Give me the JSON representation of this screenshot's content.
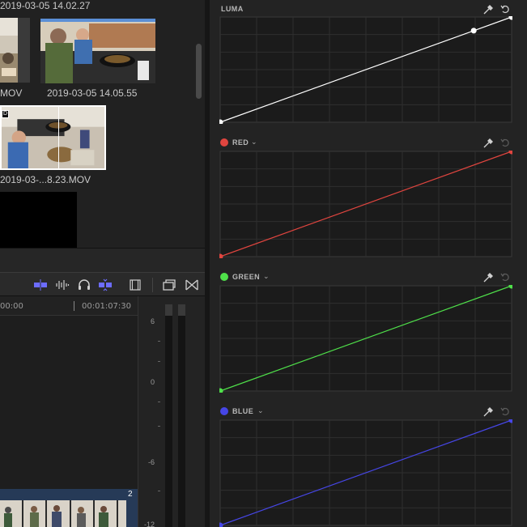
{
  "browser": {
    "clips": [
      {
        "label": "2019-03-05 14.02.27",
        "thumb": "kitchen-clip"
      },
      {
        "label": "MOV",
        "thumb": "kitchen-clip"
      },
      {
        "label": "2019-03-05 14.05.55",
        "thumb": "kitchen-clip-selected"
      },
      {
        "label": "2019-03-...8.23.MOV",
        "thumb": "kitchen-clip-skimmed"
      },
      {
        "label": "",
        "thumb": "black-clip"
      }
    ]
  },
  "timeline": {
    "toolbar_icons": [
      "video-only-icon",
      "waveform-icon",
      "headphones-icon",
      "audio-skimming-icon",
      "filmstrip-icon",
      "clip-appearance-icon",
      "transitions-icon"
    ],
    "timecodes": [
      "00:00",
      "00:01:07:30"
    ],
    "track_number": "2"
  },
  "meters": {
    "labels": [
      "6",
      "0",
      "-6",
      "-12"
    ]
  },
  "colors": {
    "luma": "#ffffff",
    "red": "#e0453f",
    "green": "#4fe04a",
    "blue": "#4646e6",
    "accent": "#5b8fd6"
  },
  "curves": [
    {
      "name": "LUMA",
      "color": "#ffffff",
      "has_dot": false,
      "has_menu": false,
      "points": [
        [
          0,
          0
        ],
        [
          0.87,
          0.87
        ],
        [
          1.0,
          1.0
        ]
      ]
    },
    {
      "name": "RED",
      "color": "#e0453f",
      "has_dot": true,
      "has_menu": true,
      "points": [
        [
          0,
          0
        ],
        [
          1.0,
          1.0
        ]
      ]
    },
    {
      "name": "GREEN",
      "color": "#4fe04a",
      "has_dot": true,
      "has_menu": true,
      "points": [
        [
          0,
          0
        ],
        [
          1.0,
          1.0
        ]
      ]
    },
    {
      "name": "BLUE",
      "color": "#4646e6",
      "has_dot": true,
      "has_menu": true,
      "points": [
        [
          0,
          0
        ],
        [
          1.0,
          1.0
        ]
      ]
    }
  ]
}
